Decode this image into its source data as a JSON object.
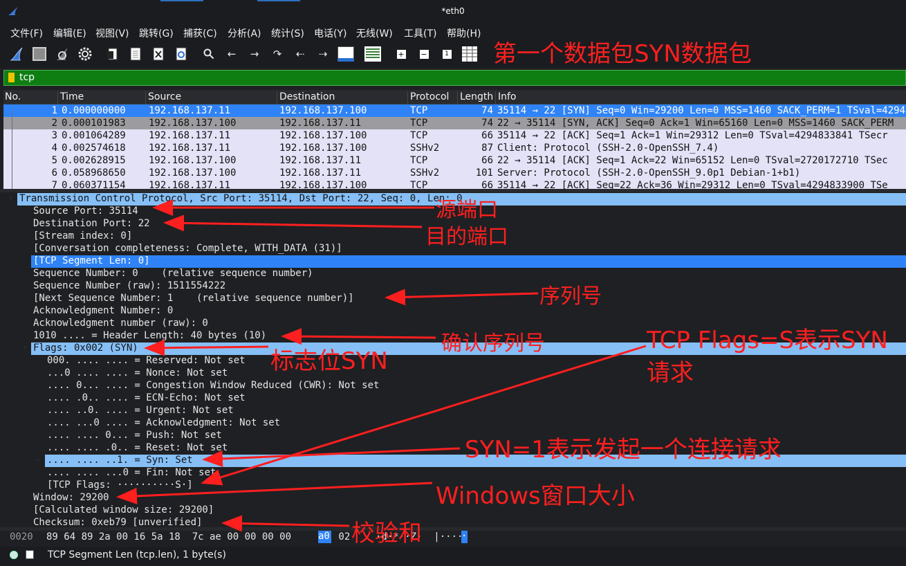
{
  "window": {
    "title": "*eth0"
  },
  "menu": [
    "文件(F)",
    "编辑(E)",
    "视图(V)",
    "跳转(G)",
    "捕获(C)",
    "分析(A)",
    "统计(S)",
    "电话(Y)",
    "无线(W)",
    "工具(T)",
    "帮助(H)"
  ],
  "toolbar_icons": [
    "shark-fin-icon",
    "stop-icon",
    "restart-icon",
    "options-gear-icon",
    "open-file-icon",
    "save-file-icon",
    "close-file-icon",
    "reload-icon",
    "search-icon",
    "back-arrow-icon",
    "forward-arrow-icon",
    "goto-packet-icon",
    "first-packet-icon",
    "last-packet-icon",
    "autoscroll-icon",
    "colorize-icon",
    "zoom-in-icon",
    "zoom-out-icon",
    "normal-size-icon",
    "resize-columns-icon"
  ],
  "filter": {
    "value": "tcp"
  },
  "columns": [
    "No.",
    "Time",
    "Source",
    "Destination",
    "Protocol",
    "Length",
    "Info"
  ],
  "packets": [
    {
      "no": "1",
      "time": "0.000000000",
      "src": "192.168.137.11",
      "dst": "192.168.137.100",
      "proto": "TCP",
      "len": "74",
      "info": "35114 → 22 [SYN] Seq=0 Win=29200 Len=0 MSS=1460 SACK_PERM=1 TSval=4294"
    },
    {
      "no": "2",
      "time": "0.000101983",
      "src": "192.168.137.100",
      "dst": "192.168.137.11",
      "proto": "TCP",
      "len": "74",
      "info": "22 → 35114 [SYN, ACK] Seq=0 Ack=1 Win=65160 Len=0 MSS=1460 SACK_PERM"
    },
    {
      "no": "3",
      "time": "0.001064289",
      "src": "192.168.137.11",
      "dst": "192.168.137.100",
      "proto": "TCP",
      "len": "66",
      "info": "35114 → 22 [ACK] Seq=1 Ack=1 Win=29312 Len=0 TSval=4294833841 TSecr"
    },
    {
      "no": "4",
      "time": "0.002574618",
      "src": "192.168.137.11",
      "dst": "192.168.137.100",
      "proto": "SSHv2",
      "len": "87",
      "info": "Client: Protocol (SSH-2.0-OpenSSH_7.4)"
    },
    {
      "no": "5",
      "time": "0.002628915",
      "src": "192.168.137.100",
      "dst": "192.168.137.11",
      "proto": "TCP",
      "len": "66",
      "info": "22 → 35114 [ACK] Seq=1 Ack=22 Win=65152 Len=0 TSval=2720172710 TSec"
    },
    {
      "no": "6",
      "time": "0.058968650",
      "src": "192.168.137.100",
      "dst": "192.168.137.11",
      "proto": "SSHv2",
      "len": "101",
      "info": "Server: Protocol (SSH-2.0-OpenSSH_9.0p1 Debian-1+b1)"
    },
    {
      "no": "7",
      "time": "0.060371154",
      "src": "192.168.137.11",
      "dst": "192.168.137.100",
      "proto": "TCP",
      "len": "66",
      "info": "35114 → 22 [ACK] Seq=22 Ack=36 Win=29312 Len=0 TSval=4294833900 TSe"
    }
  ],
  "details": [
    {
      "text": "Transmission Control Protocol, Src Port: 35114, Dst Port: 22, Seq: 0, Len: 0",
      "indent": 0,
      "tw": "down",
      "style": "hl"
    },
    {
      "text": "Source Port: 35114",
      "indent": 1
    },
    {
      "text": "Destination Port: 22",
      "indent": 1
    },
    {
      "text": "[Stream index: 0]",
      "indent": 1
    },
    {
      "text": "[Conversation completeness: Complete, WITH_DATA (31)]",
      "indent": 1
    },
    {
      "text": "[TCP Segment Len: 0]",
      "indent": 1,
      "style": "sel"
    },
    {
      "text": "Sequence Number: 0    (relative sequence number)",
      "indent": 1
    },
    {
      "text": "Sequence Number (raw): 1511554222",
      "indent": 1
    },
    {
      "text": "[Next Sequence Number: 1    (relative sequence number)]",
      "indent": 1
    },
    {
      "text": "Acknowledgment Number: 0",
      "indent": 1
    },
    {
      "text": "Acknowledgment number (raw): 0",
      "indent": 1
    },
    {
      "text": "1010 .... = Header Length: 40 bytes (10)",
      "indent": 1
    },
    {
      "text": "Flags: 0x002 (SYN)",
      "indent": 1,
      "tw": "down",
      "style": "hl"
    },
    {
      "text": "000. .... .... = Reserved: Not set",
      "indent": 2
    },
    {
      "text": "...0 .... .... = Nonce: Not set",
      "indent": 2
    },
    {
      "text": ".... 0... .... = Congestion Window Reduced (CWR): Not set",
      "indent": 2
    },
    {
      "text": ".... .0.. .... = ECN-Echo: Not set",
      "indent": 2
    },
    {
      "text": ".... ..0. .... = Urgent: Not set",
      "indent": 2
    },
    {
      "text": ".... ...0 .... = Acknowledgment: Not set",
      "indent": 2
    },
    {
      "text": ".... .... 0... = Push: Not set",
      "indent": 2
    },
    {
      "text": ".... .... .0.. = Reset: Not set",
      "indent": 2
    },
    {
      "text": ".... .... ..1. = Syn: Set",
      "indent": 2,
      "tw": "right",
      "style": "hl"
    },
    {
      "text": ".... .... ...0 = Fin: Not set",
      "indent": 2
    },
    {
      "text": "[TCP Flags: ··········S·]",
      "indent": 2
    },
    {
      "text": "Window: 29200",
      "indent": 1
    },
    {
      "text": "[Calculated window size: 29200]",
      "indent": 1
    },
    {
      "text": "Checksum: 0xeb79 [unverified]",
      "indent": 1
    }
  ],
  "bytes": {
    "offset": "0020",
    "hex_before": "89 64 89 2a 00 16 5a 18  7c ae 00 00 00 00 ",
    "hex_hl": "a0",
    "hex_after": " 02",
    "ascii_before": "·d·*··Z·  |·····",
    "ascii_hl": "·"
  },
  "status": {
    "text": "TCP Segment Len (tcp.len), 1 byte(s)"
  },
  "annotations": {
    "header": "第一个数据包SYN数据包",
    "src_port": "源端口",
    "dst_port": "目的端口",
    "seq": "序列号",
    "ack": "确认序列号",
    "flags": "标志位SYN",
    "tcp_flags_line1": "TCP Flags=S表示SYN",
    "tcp_flags_line2": "请求",
    "syn": "SYN=1表示发起一个连接请求",
    "window": "Windows窗口大小",
    "checksum": "校验和"
  },
  "colors": {
    "selection": "#2f83f6",
    "highlight": "#86bff5",
    "filter_ok": "#0e7e12",
    "annotation": "#ff1f1f",
    "packet_bg": "#e3e2f7"
  }
}
